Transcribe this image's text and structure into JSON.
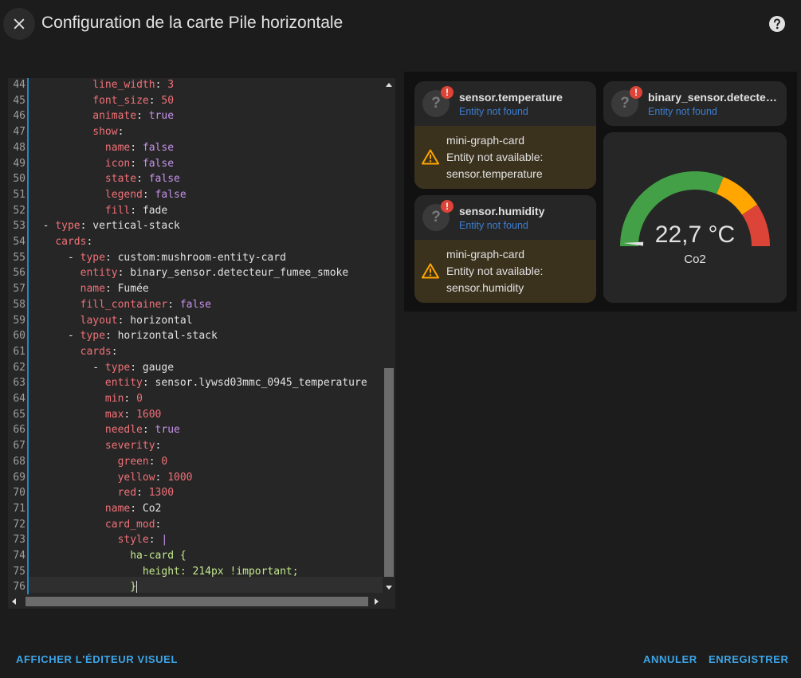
{
  "header": {
    "title": "Configuration de la carte Pile horizontale"
  },
  "editor": {
    "lines": [
      {
        "num": "44",
        "indent": "          ",
        "key": "line_width",
        "value": "3",
        "vtype": "n"
      },
      {
        "num": "45",
        "indent": "          ",
        "key": "font_size",
        "value": "50",
        "vtype": "n"
      },
      {
        "num": "46",
        "indent": "          ",
        "key": "animate",
        "value": "true",
        "vtype": "v"
      },
      {
        "num": "47",
        "indent": "          ",
        "key": "show",
        "value": "",
        "vtype": "s"
      },
      {
        "num": "48",
        "indent": "            ",
        "key": "name",
        "value": "false",
        "vtype": "v"
      },
      {
        "num": "49",
        "indent": "            ",
        "key": "icon",
        "value": "false",
        "vtype": "v"
      },
      {
        "num": "50",
        "indent": "            ",
        "key": "state",
        "value": "false",
        "vtype": "v"
      },
      {
        "num": "51",
        "indent": "            ",
        "key": "legend",
        "value": "false",
        "vtype": "v"
      },
      {
        "num": "52",
        "indent": "            ",
        "key": "fill",
        "value": "fade",
        "vtype": "s"
      },
      {
        "num": "53",
        "indent": "  - ",
        "key": "type",
        "value": "vertical-stack",
        "vtype": "s"
      },
      {
        "num": "54",
        "indent": "    ",
        "key": "cards",
        "value": "",
        "vtype": "s"
      },
      {
        "num": "55",
        "indent": "      - ",
        "key": "type",
        "value": "custom:mushroom-entity-card",
        "vtype": "s"
      },
      {
        "num": "56",
        "indent": "        ",
        "key": "entity",
        "value": "binary_sensor.detecteur_fumee_smoke",
        "vtype": "s"
      },
      {
        "num": "57",
        "indent": "        ",
        "key": "name",
        "value": "Fumée",
        "vtype": "s"
      },
      {
        "num": "58",
        "indent": "        ",
        "key": "fill_container",
        "value": "false",
        "vtype": "v"
      },
      {
        "num": "59",
        "indent": "        ",
        "key": "layout",
        "value": "horizontal",
        "vtype": "s"
      },
      {
        "num": "60",
        "indent": "      - ",
        "key": "type",
        "value": "horizontal-stack",
        "vtype": "s"
      },
      {
        "num": "61",
        "indent": "        ",
        "key": "cards",
        "value": "",
        "vtype": "s"
      },
      {
        "num": "62",
        "indent": "          - ",
        "key": "type",
        "value": "gauge",
        "vtype": "s"
      },
      {
        "num": "63",
        "indent": "            ",
        "key": "entity",
        "value": "sensor.lywsd03mmc_0945_temperature",
        "vtype": "s"
      },
      {
        "num": "64",
        "indent": "            ",
        "key": "min",
        "value": "0",
        "vtype": "n"
      },
      {
        "num": "65",
        "indent": "            ",
        "key": "max",
        "value": "1600",
        "vtype": "n"
      },
      {
        "num": "66",
        "indent": "            ",
        "key": "needle",
        "value": "true",
        "vtype": "v"
      },
      {
        "num": "67",
        "indent": "            ",
        "key": "severity",
        "value": "",
        "vtype": "s"
      },
      {
        "num": "68",
        "indent": "              ",
        "key": "green",
        "value": "0",
        "vtype": "n"
      },
      {
        "num": "69",
        "indent": "              ",
        "key": "yellow",
        "value": "1000",
        "vtype": "n"
      },
      {
        "num": "70",
        "indent": "              ",
        "key": "red",
        "value": "1300",
        "vtype": "n"
      },
      {
        "num": "71",
        "indent": "            ",
        "key": "name",
        "value": "Co2",
        "vtype": "s"
      },
      {
        "num": "72",
        "indent": "            ",
        "key": "card_mod",
        "value": "",
        "vtype": "s"
      },
      {
        "num": "73",
        "indent": "              ",
        "key": "style",
        "value": "|",
        "vtype": "v"
      },
      {
        "num": "74",
        "indent": "                ",
        "key": "",
        "value": "ha-card {",
        "vtype": "str"
      },
      {
        "num": "75",
        "indent": "                  ",
        "key": "",
        "value": "height: 214px !important;",
        "vtype": "str"
      },
      {
        "num": "76",
        "indent": "                ",
        "key": "",
        "value": "}",
        "vtype": "str"
      }
    ]
  },
  "preview": {
    "entity_temp": {
      "name": "sensor.temperature",
      "status": "Entity not found",
      "icon_glyph": "?",
      "badge": "!"
    },
    "entity_hum": {
      "name": "sensor.humidity",
      "status": "Entity not found",
      "icon_glyph": "?",
      "badge": "!"
    },
    "entity_smoke": {
      "name": "binary_sensor.detecteur_fumee_smoke",
      "status": "Entity not found",
      "icon_glyph": "?",
      "badge": "!"
    },
    "warn_temp": {
      "line1": "mini-graph-card",
      "line2": "Entity not available:",
      "line3": "sensor.temperature"
    },
    "warn_hum": {
      "line1": "mini-graph-card",
      "line2": "Entity not available:",
      "line3": "sensor.humidity"
    },
    "gauge": {
      "value": "22,7 °C",
      "name": "Co2",
      "min": 0,
      "max": 1600,
      "current": 22.7,
      "segments": [
        {
          "from": 0,
          "to": 1000,
          "color": "#43a047"
        },
        {
          "from": 1000,
          "to": 1300,
          "color": "#ffa600"
        },
        {
          "from": 1300,
          "to": 1600,
          "color": "#db4437"
        }
      ]
    }
  },
  "footer": {
    "visual_editor": "AFFICHER L'ÉDITEUR VISUEL",
    "cancel": "ANNULER",
    "save": "ENREGISTRER"
  },
  "colors": {
    "accent": "#3da5e8",
    "warning": "#ffa600",
    "error": "#db4437"
  }
}
